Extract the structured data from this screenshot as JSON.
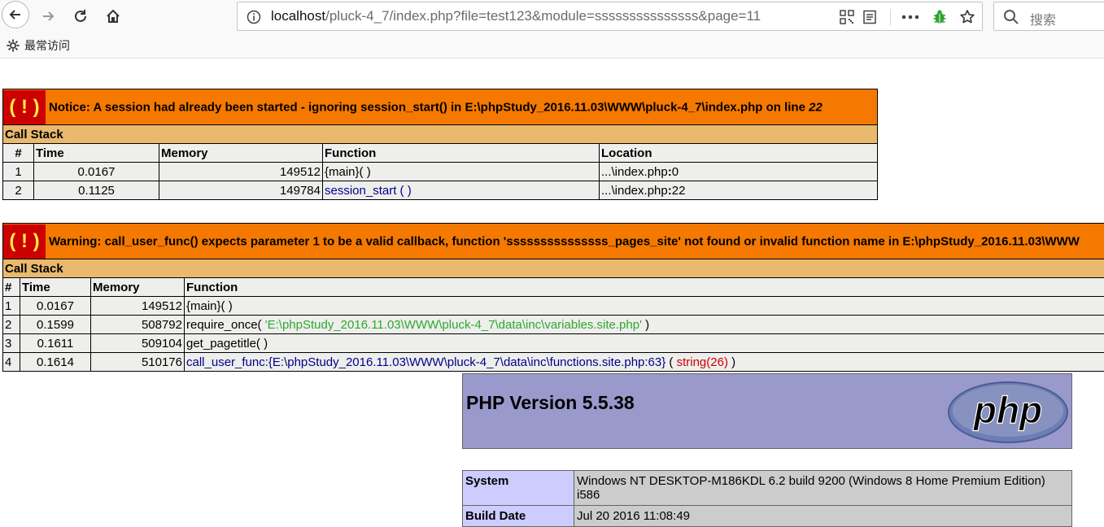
{
  "browser": {
    "url_host": "localhost",
    "url_path": "/pluck-4_7/index.php?file=test123&module=sssssssssssssss&page=11",
    "search_placeholder": "搜索",
    "bookmark_label": "最常访问"
  },
  "notice": {
    "marker": "( ! )",
    "message": "Notice: A session had already been started - ignoring session_start() in E:\\phpStudy_2016.11.03\\WWW\\pluck-4_7\\index.php on line ",
    "line": "22",
    "call_stack_label": "Call Stack",
    "headers": [
      "#",
      "Time",
      "Memory",
      "Function",
      "Location"
    ],
    "rows": [
      {
        "n": "1",
        "time": "0.0167",
        "memory": "149512",
        "function": "{main}( )",
        "location_dir": "...\\index.php",
        "location_line": "0"
      },
      {
        "n": "2",
        "time": "0.1125",
        "memory": "149784",
        "function": "session_start ( )",
        "location_dir": "...\\index.php",
        "location_line": "22"
      }
    ]
  },
  "warning": {
    "marker": "( ! )",
    "message": "Warning: call_user_func() expects parameter 1 to be a valid callback, function 'sssssssssssssss_pages_site' not found or invalid function name in E:\\phpStudy_2016.11.03\\WWW",
    "call_stack_label": "Call Stack",
    "headers": [
      "#",
      "Time",
      "Memory",
      "Function"
    ],
    "rows": [
      {
        "n": "1",
        "time": "0.0167",
        "memory": "149512",
        "fn": "{main}( )"
      },
      {
        "n": "2",
        "time": "0.1599",
        "memory": "508792",
        "fn": "require_once( ",
        "arg": "'E:\\phpStudy_2016.11.03\\WWW\\pluck-4_7\\data\\inc\\variables.site.php'",
        "tail": " )"
      },
      {
        "n": "3",
        "time": "0.1611",
        "memory": "509104",
        "fn": "get_pagetitle( )"
      },
      {
        "n": "4",
        "time": "0.1614",
        "memory": "510176",
        "fn": "call_user_func:{E:\\phpStudy_2016.11.03\\WWW\\pluck-4_7\\data\\inc\\functions.site.php:63}",
        "arg": "string(26)",
        "pre": " ( ",
        "tail": " )"
      }
    ]
  },
  "phpinfo": {
    "title": "PHP Version 5.5.38",
    "logo_text": "php",
    "rows": [
      {
        "key": "System",
        "value": "Windows NT DESKTOP-M186KDL 6.2 build 9200 (Windows 8 Home Premium Edition) i586"
      },
      {
        "key": "Build Date",
        "value": "Jul 20 2016 11:08:49"
      }
    ]
  }
}
